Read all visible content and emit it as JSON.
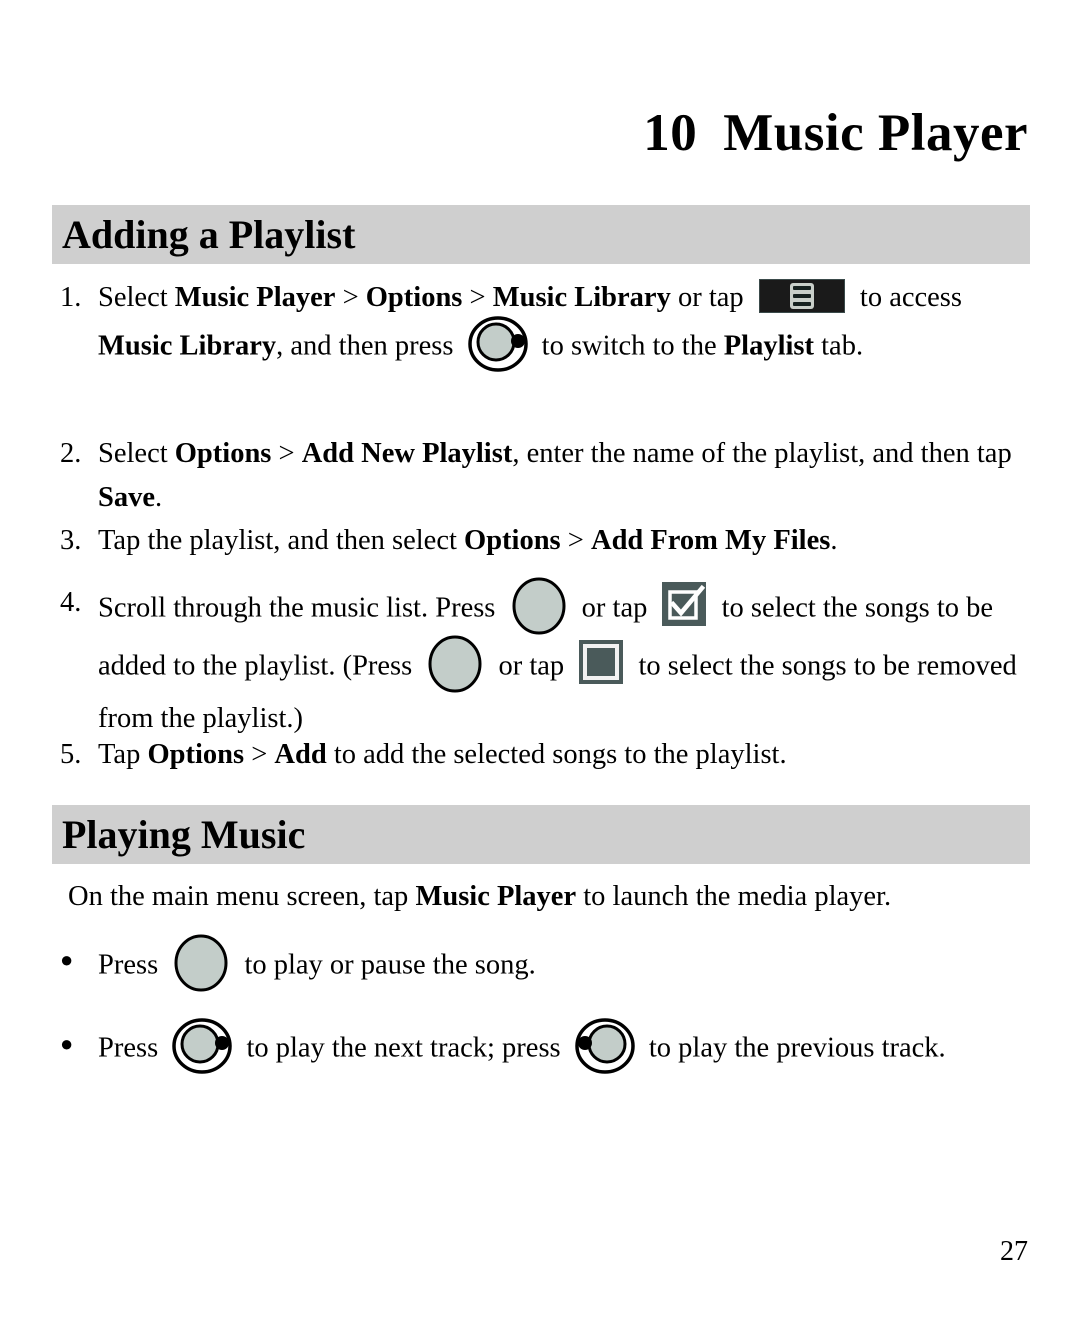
{
  "document": {
    "chapter_number": "10",
    "chapter_title": "Music Player",
    "page_number": "27"
  },
  "colors": {
    "section_bar_bg": "#cfcfcf",
    "text": "#000000",
    "icon_dark": "#4a5a5a",
    "icon_key_fill": "#c3cdc9",
    "menu_icon_bg": "#1a1a1a"
  },
  "sections": [
    {
      "id": "adding-a-playlist",
      "heading": "Adding a Playlist",
      "steps": [
        {
          "marker": "1.",
          "parts": [
            {
              "type": "text",
              "value": "Select "
            },
            {
              "type": "bold",
              "value": "Music Player"
            },
            {
              "type": "text",
              "value": " > "
            },
            {
              "type": "bold",
              "value": "Options"
            },
            {
              "type": "text",
              "value": " > "
            },
            {
              "type": "bold",
              "value": "Music Library"
            },
            {
              "type": "text",
              "value": " or tap "
            },
            {
              "type": "icon",
              "value": "menu-softkey-icon"
            },
            {
              "type": "text",
              "value": " to access "
            },
            {
              "type": "bold",
              "value": "Music Library"
            },
            {
              "type": "text",
              "value": ", and then press "
            },
            {
              "type": "icon",
              "value": "nav-right-key-icon"
            },
            {
              "type": "text",
              "value": " to switch to the "
            },
            {
              "type": "bold",
              "value": "Playlist"
            },
            {
              "type": "text",
              "value": " tab."
            }
          ]
        },
        {
          "marker": "2.",
          "parts": [
            {
              "type": "text",
              "value": "Select "
            },
            {
              "type": "bold",
              "value": "Options"
            },
            {
              "type": "text",
              "value": " > "
            },
            {
              "type": "bold",
              "value": "Add New Playlist"
            },
            {
              "type": "text",
              "value": ", enter the name of the playlist, and then tap "
            },
            {
              "type": "bold",
              "value": "Save"
            },
            {
              "type": "text",
              "value": "."
            }
          ]
        },
        {
          "marker": "3.",
          "parts": [
            {
              "type": "text",
              "value": "Tap the playlist, and then select "
            },
            {
              "type": "bold",
              "value": "Options"
            },
            {
              "type": "text",
              "value": " > "
            },
            {
              "type": "bold",
              "value": "Add From My Files"
            },
            {
              "type": "text",
              "value": "."
            }
          ]
        },
        {
          "marker": "4.",
          "parts": [
            {
              "type": "text",
              "value": "Scroll through the music list. Press "
            },
            {
              "type": "icon",
              "value": "ok-key-icon"
            },
            {
              "type": "text",
              "value": " or tap "
            },
            {
              "type": "icon",
              "value": "checkbox-checked-icon"
            },
            {
              "type": "text",
              "value": " to select the songs to be added to the playlist. (Press "
            },
            {
              "type": "icon",
              "value": "ok-key-icon"
            },
            {
              "type": "text",
              "value": " or tap "
            },
            {
              "type": "icon",
              "value": "checkbox-unchecked-icon"
            },
            {
              "type": "text",
              "value": " to select the songs to be removed from the playlist.)"
            }
          ]
        },
        {
          "marker": "5.",
          "parts": [
            {
              "type": "text",
              "value": "Tap "
            },
            {
              "type": "bold",
              "value": "Options"
            },
            {
              "type": "text",
              "value": " > "
            },
            {
              "type": "bold",
              "value": "Add"
            },
            {
              "type": "text",
              "value": " to add the selected songs to the playlist."
            }
          ]
        }
      ]
    },
    {
      "id": "playing-music",
      "heading": "Playing Music",
      "intro": [
        {
          "type": "text",
          "value": "On the main menu screen, tap "
        },
        {
          "type": "bold",
          "value": "Music Player"
        },
        {
          "type": "text",
          "value": " to launch the media player."
        }
      ],
      "bullets": [
        {
          "marker": "●",
          "parts": [
            {
              "type": "text",
              "value": "Press "
            },
            {
              "type": "icon",
              "value": "ok-key-icon"
            },
            {
              "type": "text",
              "value": " to play or pause the song."
            }
          ]
        },
        {
          "marker": "●",
          "parts": [
            {
              "type": "text",
              "value": "Press "
            },
            {
              "type": "icon",
              "value": "nav-right-key-icon"
            },
            {
              "type": "text",
              "value": " to play the next track; press "
            },
            {
              "type": "icon",
              "value": "nav-left-key-icon"
            },
            {
              "type": "text",
              "value": " to play the previous track."
            }
          ]
        }
      ]
    }
  ],
  "text": {
    "step1_a": "Select ",
    "step1_music_player": "Music Player",
    "step1_gt1": " > ",
    "step1_options": "Options",
    "step1_gt2": " > ",
    "step1_music_library": "Music Library",
    "step1_b": " or tap ",
    "step1_c": " to access ",
    "step1_music_library2": "Music Library",
    "step1_d": ", and then press ",
    "step1_e": " to switch to the ",
    "step1_playlist": "Playlist",
    "step1_f": " tab.",
    "step2_a": "Select ",
    "step2_options": "Options",
    "step2_gt": " > ",
    "step2_add_new_playlist": "Add New Playlist",
    "step2_b": ", enter the name of the playlist, and then tap ",
    "step2_save": "Save",
    "step2_c": ".",
    "step3_a": "Tap the playlist, and then select ",
    "step3_options": "Options",
    "step3_gt": " > ",
    "step3_add_from_my_files": "Add From My Files",
    "step3_b": ".",
    "step4_a": "Scroll through the music list. Press ",
    "step4_b": " or tap ",
    "step4_c": " to select the songs to be added to the playlist. (Press ",
    "step4_d": " or tap ",
    "step4_e": " to select the songs to be removed from the playlist.)",
    "step5_a": "Tap ",
    "step5_options": "Options",
    "step5_gt": " > ",
    "step5_add": "Add",
    "step5_b": " to add the selected songs to the playlist.",
    "intro_a": "On the main menu screen, tap ",
    "intro_music_player": "Music Player",
    "intro_b": " to launch the media player.",
    "bullet1_a": "Press ",
    "bullet1_b": " to play or pause the song.",
    "bullet2_a": "Press ",
    "bullet2_b": " to play the next track; press ",
    "bullet2_c": " to play the previous track.",
    "marker1": "1.",
    "marker2": "2.",
    "marker3": "3.",
    "marker4": "4.",
    "marker5": "5.",
    "bullet_marker": "●"
  }
}
